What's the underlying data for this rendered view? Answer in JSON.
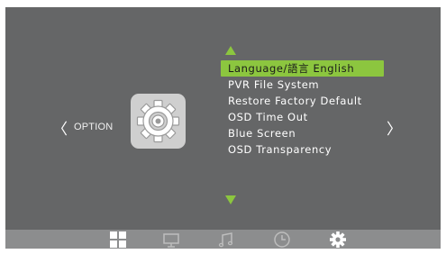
{
  "menu_page": {
    "section_label": "OPTION",
    "nav_left_glyph": "〈",
    "nav_right_glyph": "〉",
    "section_icon": "gear-icon"
  },
  "menu": {
    "items": [
      {
        "label": "Language/語言 English",
        "selected": true
      },
      {
        "label": "PVR File System",
        "selected": false
      },
      {
        "label": "Restore Factory Default",
        "selected": false
      },
      {
        "label": "OSD Time Out",
        "selected": false
      },
      {
        "label": "Blue Screen",
        "selected": false
      },
      {
        "label": "OSD Transparency",
        "selected": false
      }
    ],
    "scroll_up_icon": "triangle-up-icon",
    "scroll_down_icon": "triangle-down-icon"
  },
  "tab_bar": {
    "tabs": [
      {
        "icon": "grid-icon",
        "active": false
      },
      {
        "icon": "monitor-icon",
        "active": false
      },
      {
        "icon": "music-note-icon",
        "active": false
      },
      {
        "icon": "clock-icon",
        "active": false
      },
      {
        "icon": "gear-icon",
        "active": true
      }
    ]
  },
  "colors": {
    "background": "#656667",
    "accent": "#8cc63f",
    "tab_bar": "#8c8d8e",
    "tile": "#cfcfcf"
  }
}
